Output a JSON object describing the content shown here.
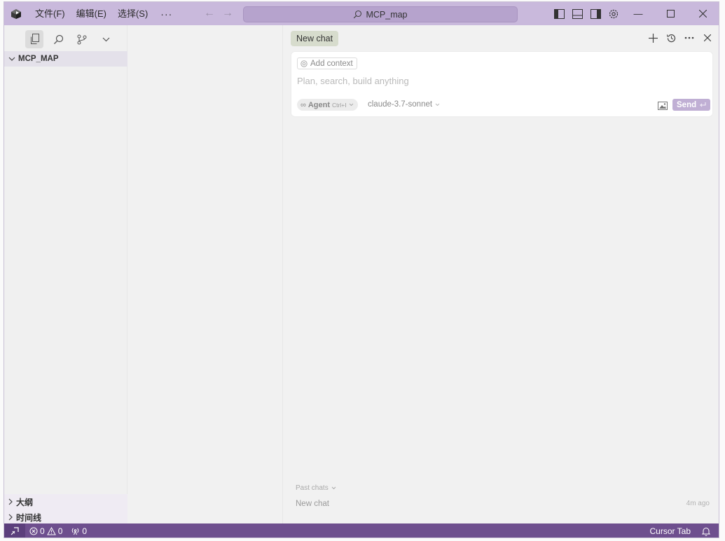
{
  "window": {
    "menu": [
      "文件(F)",
      "编辑(E)",
      "选择(S)"
    ],
    "menu_more": "···",
    "command_center": "MCP_map"
  },
  "sidebar": {
    "root_folder": "MCP_MAP",
    "bottom_sections": [
      "大纲",
      "时间线"
    ]
  },
  "chat": {
    "tab_label": "New chat",
    "add_context": "Add context",
    "input_placeholder": "Plan, search, build anything",
    "agent_label": "Agent",
    "agent_shortcut": "Ctrl+I",
    "model": "claude-3.7-sonnet",
    "send_label": "Send",
    "past_chats_label": "Past chats",
    "past_chats": [
      {
        "title": "New chat",
        "time": "4m ago"
      }
    ]
  },
  "statusbar": {
    "errors": "0",
    "warnings": "0",
    "ports": "0",
    "cursor_tab": "Cursor Tab"
  },
  "colors": {
    "titlebar": "#c9b9dc",
    "statusbar": "#6e4f8e",
    "send_button": "#c0afd4",
    "new_chat_tab": "#d7dccd"
  }
}
